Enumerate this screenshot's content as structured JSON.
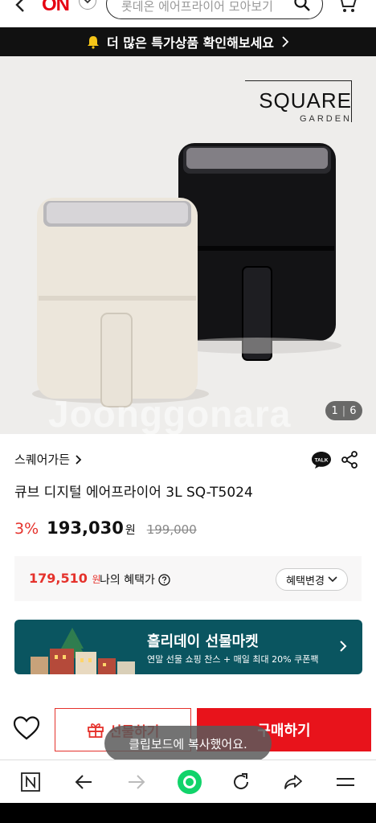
{
  "header": {
    "logo": "ON",
    "search_placeholder": "롯데온 에어프라이어 모아보기"
  },
  "promo": {
    "text": "더 많은 특가상품 확인해보세요"
  },
  "product_image": {
    "brand_main": "SQUARE",
    "brand_sub": "GARDEN",
    "watermark": "Joonggonara",
    "current_image": "1",
    "total_images": "6"
  },
  "product": {
    "brand": "스퀘어가든",
    "title": "큐브 디지털 에어프라이어 3L SQ-T5024",
    "discount": "3%",
    "price": "193,030",
    "currency": "원",
    "original_price": "199,000"
  },
  "benefit": {
    "price": "179,510",
    "currency": "원",
    "label": "나의 혜택가",
    "change_button": "혜택변경"
  },
  "banner": {
    "title": "홀리데이 선물마켓",
    "subtitle": "연말 선물 쇼핑 찬스 + 매일 최대 20% 쿠폰팩",
    "bg_color": "#0a5560"
  },
  "actions": {
    "gift_label": "선물하기",
    "buy_label": "구매하기",
    "accent_color": "#e8131b"
  },
  "toast": {
    "text": "클립보드에 복사했어요."
  },
  "talk_icon_label": "TALK"
}
